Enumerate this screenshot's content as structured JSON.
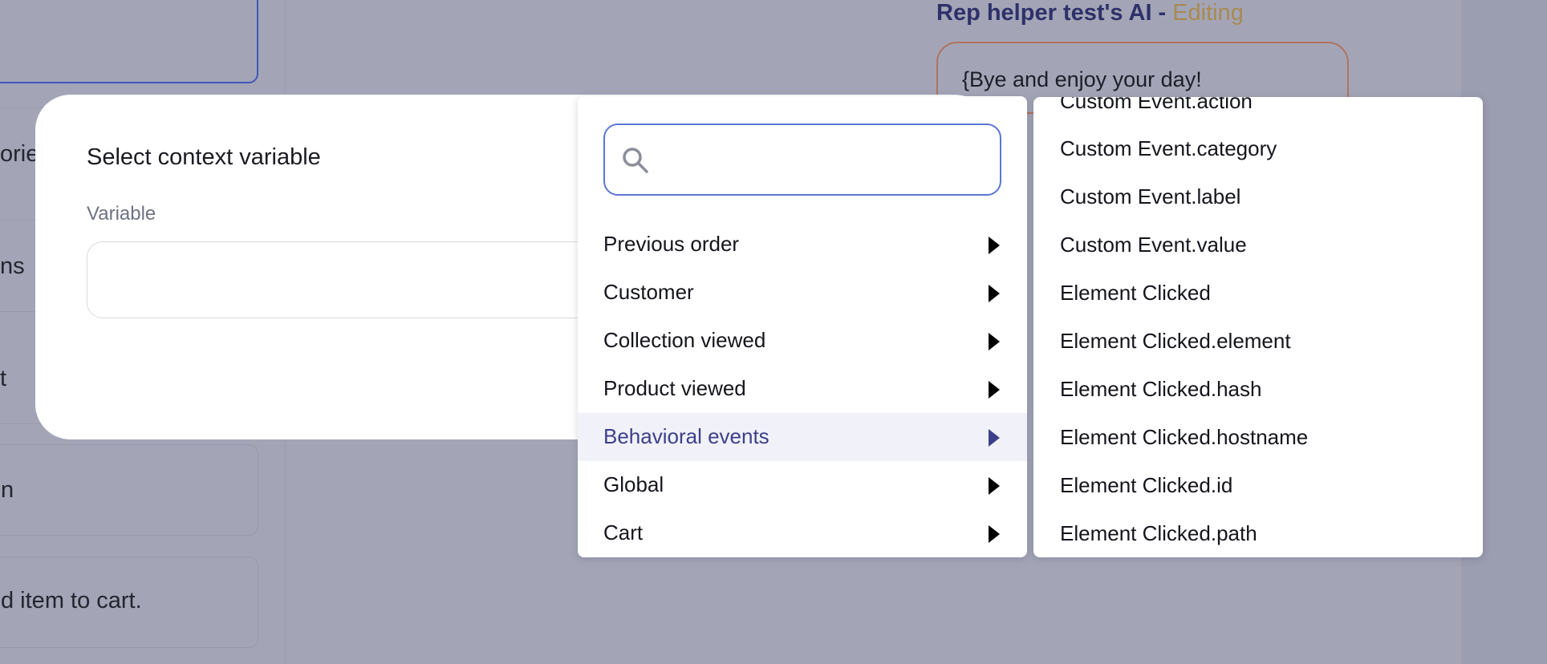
{
  "background": {
    "left_cards": [
      {
        "text": "",
        "focused": true
      },
      {
        "text": "orie"
      },
      {
        "text": "ns"
      },
      {
        "text": "t"
      },
      {
        "text": "n"
      },
      {
        "text": "d item to cart."
      }
    ],
    "ai_panel": {
      "title": "Rep helper test's AI",
      "separator": "-",
      "status": "Editing",
      "message": "{Bye and enjoy your day!"
    }
  },
  "modal": {
    "title": "Select context variable",
    "variable_label": "Variable",
    "variable_value": ""
  },
  "menu": {
    "search": {
      "value": "",
      "placeholder": "",
      "icon": "search-icon"
    },
    "items": [
      {
        "label": "Previous order",
        "active": false
      },
      {
        "label": "Customer",
        "active": false
      },
      {
        "label": "Collection viewed",
        "active": false
      },
      {
        "label": "Product viewed",
        "active": false
      },
      {
        "label": "Behavioral events",
        "active": true
      },
      {
        "label": "Global",
        "active": false
      },
      {
        "label": "Cart",
        "active": false
      }
    ]
  },
  "submenu": {
    "items": [
      {
        "label": "Custom Event.action"
      },
      {
        "label": "Custom Event.category"
      },
      {
        "label": "Custom Event.label"
      },
      {
        "label": "Custom Event.value"
      },
      {
        "label": "Element Clicked"
      },
      {
        "label": "Element Clicked.element"
      },
      {
        "label": "Element Clicked.hash"
      },
      {
        "label": "Element Clicked.hostname"
      },
      {
        "label": "Element Clicked.id"
      },
      {
        "label": "Element Clicked.path"
      }
    ]
  },
  "colors": {
    "overlay": "#a3a5b7",
    "accent": "#3d3f8a",
    "search_border": "#5b76d6",
    "editing": "#a88a52"
  }
}
